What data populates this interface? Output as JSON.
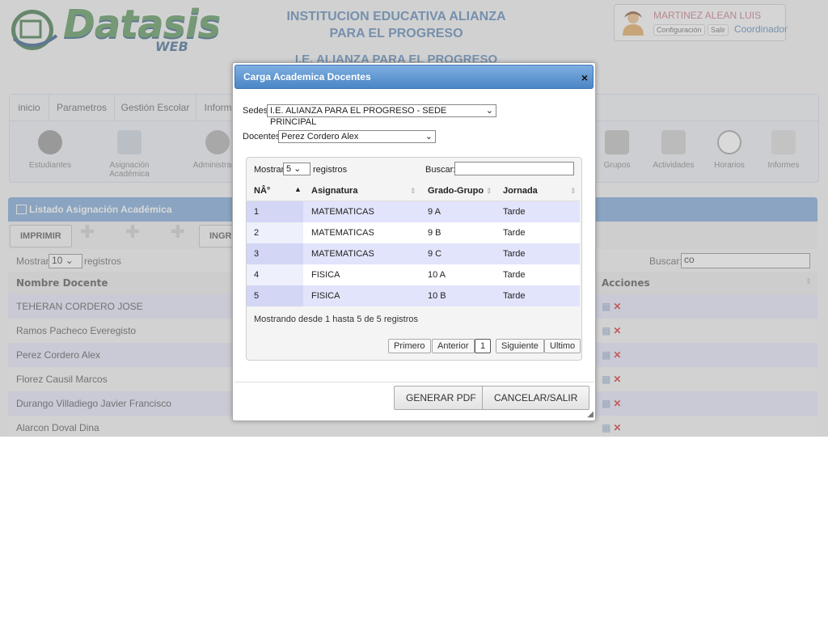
{
  "brand": {
    "name": "Datasis",
    "sub": "WEB"
  },
  "institution": {
    "line1": "INSTITUCION EDUCATIVA ALIANZA",
    "line2": "PARA EL PROGRESO",
    "line3": "I.E. ALIANZA PARA EL PROGRESO"
  },
  "user": {
    "name": "MARTINEZ ALEAN LUIS",
    "config_label": "Configuración",
    "logout_label": "Salir",
    "role": "Coordinador"
  },
  "menu": {
    "tabs": [
      "inicio",
      "Parametros",
      "Gestión Escolar",
      "Informe"
    ],
    "icons": [
      {
        "label": "Estudiantes",
        "icon": "student-icon"
      },
      {
        "label": "Asignación Académica",
        "icon": "assignment-icon"
      },
      {
        "label": "Administrar D",
        "icon": "teacher-icon"
      },
      {
        "label": "Grupos",
        "icon": "groups-icon"
      },
      {
        "label": "Actividades",
        "icon": "activities-icon"
      },
      {
        "label": "Horarios",
        "icon": "clock-icon"
      },
      {
        "label": "Informes",
        "icon": "reports-icon"
      }
    ]
  },
  "listado": {
    "title": "Listado Asignación Académica",
    "print_label": "IMPRIMIR",
    "ingresar_label": "INGR",
    "show_label": "Mostrar",
    "show_value": "10",
    "records_label": "registros",
    "search_label": "Buscar:",
    "search_value": "co",
    "col_name": "Nombre Docente",
    "col_actions": "Acciones",
    "rows": [
      "TEHERAN CORDERO JOSE",
      "Ramos Pacheco Everegisto",
      "Perez Cordero Alex",
      "Florez Causil Marcos",
      "Durango Villadiego Javier Francisco",
      "Alarcon Doval Dina"
    ]
  },
  "dialog": {
    "title": "Carga Academica Docentes",
    "close": "×",
    "sedes_label": "Sedes",
    "sedes_value": "I.E. ALIANZA PARA EL PROGRESO - SEDE PRINCIPAL",
    "docentes_label": "Docentes",
    "docentes_value": "Perez Cordero Alex",
    "show_label": "Mostrar",
    "show_value": "5",
    "records_label": "registros",
    "search_label": "Buscar:",
    "search_value": "",
    "columns": [
      "NÂ°",
      "Asignatura",
      "Grado-Grupo",
      "Jornada"
    ],
    "rows": [
      {
        "n": "1",
        "asignatura": "MATEMATICAS",
        "grado": "9 A",
        "jornada": "Tarde"
      },
      {
        "n": "2",
        "asignatura": "MATEMATICAS",
        "grado": "9 B",
        "jornada": "Tarde"
      },
      {
        "n": "3",
        "asignatura": "MATEMATICAS",
        "grado": "9 C",
        "jornada": "Tarde"
      },
      {
        "n": "4",
        "asignatura": "FISICA",
        "grado": "10 A",
        "jornada": "Tarde"
      },
      {
        "n": "5",
        "asignatura": "FISICA",
        "grado": "10 B",
        "jornada": "Tarde"
      }
    ],
    "info": "Mostrando desde 1 hasta 5 de 5 registros",
    "pager": {
      "first": "Primero",
      "prev": "Anterior",
      "page": "1",
      "next": "Siguiente",
      "last": "Ultimo"
    },
    "pdf_label": "GENERAR PDF",
    "cancel_label": "CANCELAR/SALIR"
  },
  "colors": {
    "accent": "#4a7bb0",
    "header_blue": "#6f9fd3",
    "row_alt": "#e2e4f8",
    "user_name": "#c06a79",
    "delete_red": "#d11c1c"
  }
}
